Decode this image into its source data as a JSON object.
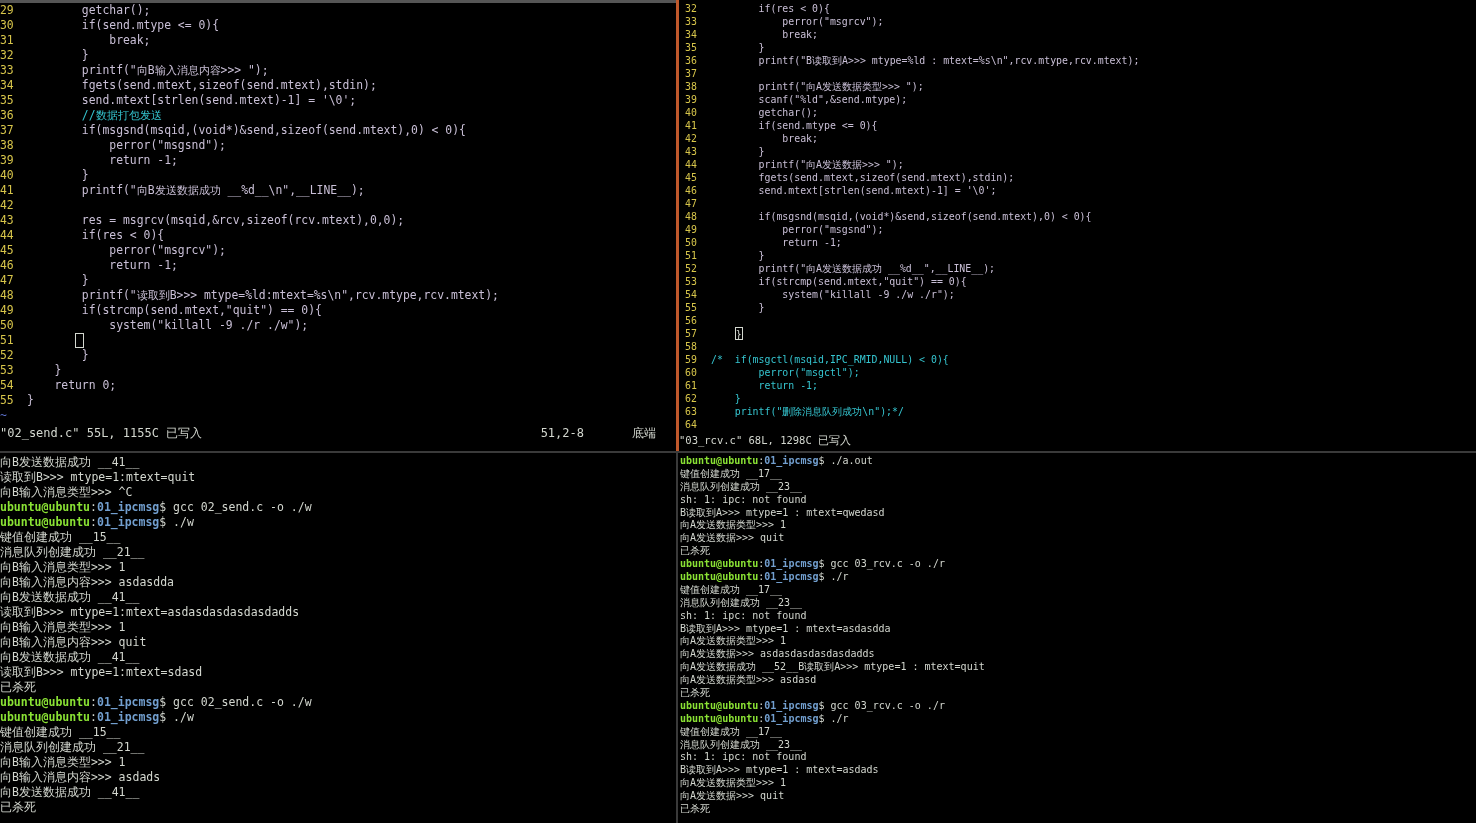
{
  "editor_left": {
    "lines": [
      {
        "n": "29",
        "code": "        getchar();"
      },
      {
        "n": "30",
        "code": "        if(send.mtype <= 0){"
      },
      {
        "n": "31",
        "code": "            break;"
      },
      {
        "n": "32",
        "code": "        }"
      },
      {
        "n": "33",
        "code": "        printf(\"向B输入消息内容>>> \");"
      },
      {
        "n": "34",
        "code": "        fgets(send.mtext,sizeof(send.mtext),stdin);"
      },
      {
        "n": "35",
        "code": "        send.mtext[strlen(send.mtext)-1] = '\\0';"
      },
      {
        "n": "36",
        "code": "        //数据打包发送",
        "kind": "comment"
      },
      {
        "n": "37",
        "code": "        if(msgsnd(msqid,(void*)&send,sizeof(send.mtext),0) < 0){"
      },
      {
        "n": "38",
        "code": "            perror(\"msgsnd\");"
      },
      {
        "n": "39",
        "code": "            return -1;"
      },
      {
        "n": "40",
        "code": "        }"
      },
      {
        "n": "41",
        "code": "        printf(\"向B发送数据成功 __%d__\\n\",__LINE__);"
      },
      {
        "n": "42"
      },
      {
        "n": "43",
        "code": "        res = msgrcv(msqid,&rcv,sizeof(rcv.mtext),0,0);"
      },
      {
        "n": "44",
        "code": "        if(res < 0){"
      },
      {
        "n": "45",
        "code": "            perror(\"msgrcv\");"
      },
      {
        "n": "46",
        "code": "            return -1;"
      },
      {
        "n": "47",
        "code": "        }"
      },
      {
        "n": "48",
        "code": "        printf(\"读取到B>>> mtype=%ld:mtext=%s\\n\",rcv.mtype,rcv.mtext);"
      },
      {
        "n": "49",
        "code": "        if(strcmp(send.mtext,\"quit\") == 0){"
      },
      {
        "n": "50",
        "code": "            system(\"killall -9 ./r ./w\");"
      },
      {
        "n": "51",
        "cursor": true
      },
      {
        "n": "52",
        "code": "        }"
      },
      {
        "n": "53",
        "code": "    }"
      },
      {
        "n": "54",
        "code": "    return 0;"
      },
      {
        "n": "55",
        "code": "}"
      }
    ],
    "filler": "~",
    "status": {
      "file": "\"02_send.c\" 55L, 1155C 已写入",
      "position": "51,2-8",
      "scroll": "底端"
    }
  },
  "editor_right": {
    "lines": [
      {
        "n": "32",
        "code": "        if(res < 0){"
      },
      {
        "n": "33",
        "code": "            perror(\"msgrcv\");"
      },
      {
        "n": "34",
        "code": "            break;"
      },
      {
        "n": "35",
        "code": "        }"
      },
      {
        "n": "36",
        "code": "        printf(\"B读取到A>>> mtype=%ld : mtext=%s\\n\",rcv.mtype,rcv.mtext);"
      },
      {
        "n": "37"
      },
      {
        "n": "38",
        "code": "        printf(\"向A发送数据类型>>> \");"
      },
      {
        "n": "39",
        "code": "        scanf(\"%ld\",&send.mtype);"
      },
      {
        "n": "40",
        "code": "        getchar();"
      },
      {
        "n": "41",
        "code": "        if(send.mtype <= 0){"
      },
      {
        "n": "42",
        "code": "            break;"
      },
      {
        "n": "43",
        "code": "        }"
      },
      {
        "n": "44",
        "code": "        printf(\"向A发送数据>>> \");"
      },
      {
        "n": "45",
        "code": "        fgets(send.mtext,sizeof(send.mtext),stdin);"
      },
      {
        "n": "46",
        "code": "        send.mtext[strlen(send.mtext)-1] = '\\0';"
      },
      {
        "n": "47"
      },
      {
        "n": "48",
        "code": "        if(msgsnd(msqid,(void*)&send,sizeof(send.mtext),0) < 0){"
      },
      {
        "n": "49",
        "code": "            perror(\"msgsnd\");"
      },
      {
        "n": "50",
        "code": "            return -1;"
      },
      {
        "n": "51",
        "code": "        }"
      },
      {
        "n": "52",
        "code": "        printf(\"向A发送数据成功 __%d__\",__LINE__);"
      },
      {
        "n": "53",
        "code": "        if(strcmp(send.mtext,\"quit\") == 0){"
      },
      {
        "n": "54",
        "code": "            system(\"killall -9 ./w ./r\");"
      },
      {
        "n": "55",
        "code": "        }"
      },
      {
        "n": "56"
      },
      {
        "n": "57",
        "cursor_text": "}"
      },
      {
        "n": "58"
      },
      {
        "n": "59",
        "code": "/*  if(msgctl(msqid,IPC_RMID,NULL) < 0){",
        "kind": "comment"
      },
      {
        "n": "60",
        "code": "        perror(\"msgctl\");",
        "kind": "comment"
      },
      {
        "n": "61",
        "code": "        return -1;",
        "kind": "comment"
      },
      {
        "n": "62",
        "code": "    }",
        "kind": "comment"
      },
      {
        "n": "63",
        "code": "    printf(\"删除消息队列成功\\n\");*/",
        "kind": "comment"
      },
      {
        "n": "64"
      }
    ],
    "status": {
      "file": "\"03_rcv.c\" 68L, 1298C 已写入"
    }
  },
  "terminal_left": {
    "lines": [
      {
        "kind": "output",
        "text": "向B发送数据成功 __41__"
      },
      {
        "kind": "output",
        "text": "读取到B>>> mtype=1:mtext=quit"
      },
      {
        "kind": "output",
        "text": "向B输入消息类型>>> ^C"
      },
      {
        "kind": "prompt",
        "user": "ubuntu@ubuntu",
        "sep": ":",
        "path": "01_ipcmsg",
        "command": "$ gcc 02_send.c -o ./w"
      },
      {
        "kind": "prompt",
        "user": "ubuntu@ubuntu",
        "sep": ":",
        "path": "01_ipcmsg",
        "command": "$ ./w"
      },
      {
        "kind": "output",
        "text": "键值创建成功 __15__"
      },
      {
        "kind": "output",
        "text": "消息队列创建成功 __21__"
      },
      {
        "kind": "output",
        "text": "向B输入消息类型>>> 1"
      },
      {
        "kind": "output",
        "text": "向B输入消息内容>>> asdasdda"
      },
      {
        "kind": "output",
        "text": "向B发送数据成功 __41__"
      },
      {
        "kind": "output",
        "text": "读取到B>>> mtype=1:mtext=asdasdasdasdasdadds"
      },
      {
        "kind": "output",
        "text": "向B输入消息类型>>> 1"
      },
      {
        "kind": "output",
        "text": "向B输入消息内容>>> quit"
      },
      {
        "kind": "output",
        "text": "向B发送数据成功 __41__"
      },
      {
        "kind": "output",
        "text": "读取到B>>> mtype=1:mtext=sdasd"
      },
      {
        "kind": "output",
        "text": "已杀死"
      },
      {
        "kind": "prompt",
        "user": "ubuntu@ubuntu",
        "sep": ":",
        "path": "01_ipcmsg",
        "command": "$ gcc 02_send.c -o ./w"
      },
      {
        "kind": "prompt",
        "user": "ubuntu@ubuntu",
        "sep": ":",
        "path": "01_ipcmsg",
        "command": "$ ./w"
      },
      {
        "kind": "output",
        "text": "键值创建成功 __15__"
      },
      {
        "kind": "output",
        "text": "消息队列创建成功 __21__"
      },
      {
        "kind": "output",
        "text": "向B输入消息类型>>> 1"
      },
      {
        "kind": "output",
        "text": "向B输入消息内容>>> asdads"
      },
      {
        "kind": "output",
        "text": "向B发送数据成功 __41__"
      },
      {
        "kind": "output",
        "text": "已杀死"
      }
    ]
  },
  "terminal_right": {
    "lines": [
      {
        "kind": "prompt",
        "user": "ubuntu@ubuntu",
        "sep": ":",
        "path": "01_ipcmsg",
        "command": "$ ./a.out"
      },
      {
        "kind": "output",
        "text": "键值创建成功 __17__"
      },
      {
        "kind": "output",
        "text": "消息队列创建成功 __23__"
      },
      {
        "kind": "output",
        "text": "sh: 1: ipc: not found"
      },
      {
        "kind": "output",
        "text": "B读取到A>>> mtype=1 : mtext=qwedasd"
      },
      {
        "kind": "output",
        "text": "向A发送数据类型>>> 1"
      },
      {
        "kind": "output",
        "text": "向A发送数据>>> quit"
      },
      {
        "kind": "output",
        "text": "已杀死"
      },
      {
        "kind": "prompt",
        "user": "ubuntu@ubuntu",
        "sep": ":",
        "path": "01_ipcmsg",
        "command": "$ gcc 03_rcv.c -o ./r"
      },
      {
        "kind": "prompt",
        "user": "ubuntu@ubuntu",
        "sep": ":",
        "path": "01_ipcmsg",
        "command": "$ ./r"
      },
      {
        "kind": "output",
        "text": "键值创建成功 __17__"
      },
      {
        "kind": "output",
        "text": "消息队列创建成功 __23__"
      },
      {
        "kind": "output",
        "text": "sh: 1: ipc: not found"
      },
      {
        "kind": "output",
        "text": "B读取到A>>> mtype=1 : mtext=asdasdda"
      },
      {
        "kind": "output",
        "text": "向A发送数据类型>>> 1"
      },
      {
        "kind": "output",
        "text": "向A发送数据>>> asdasdasdasdasdadds"
      },
      {
        "kind": "output",
        "text": "向A发送数据成功 __52__B读取到A>>> mtype=1 : mtext=quit"
      },
      {
        "kind": "output",
        "text": "向A发送数据类型>>> asdasd"
      },
      {
        "kind": "output",
        "text": "已杀死"
      },
      {
        "kind": "prompt",
        "user": "ubuntu@ubuntu",
        "sep": ":",
        "path": "01_ipcmsg",
        "command": "$ gcc 03_rcv.c -o ./r"
      },
      {
        "kind": "prompt",
        "user": "ubuntu@ubuntu",
        "sep": ":",
        "path": "01_ipcmsg",
        "command": "$ ./r"
      },
      {
        "kind": "output",
        "text": "键值创建成功 __17__"
      },
      {
        "kind": "output",
        "text": "消息队列创建成功 __23__"
      },
      {
        "kind": "output",
        "text": "sh: 1: ipc: not found"
      },
      {
        "kind": "output",
        "text": "B读取到A>>> mtype=1 : mtext=asdads"
      },
      {
        "kind": "output",
        "text": "向A发送数据类型>>> 1"
      },
      {
        "kind": "output",
        "text": "向A发送数据>>> quit"
      },
      {
        "kind": "output",
        "text": "已杀死"
      }
    ]
  }
}
